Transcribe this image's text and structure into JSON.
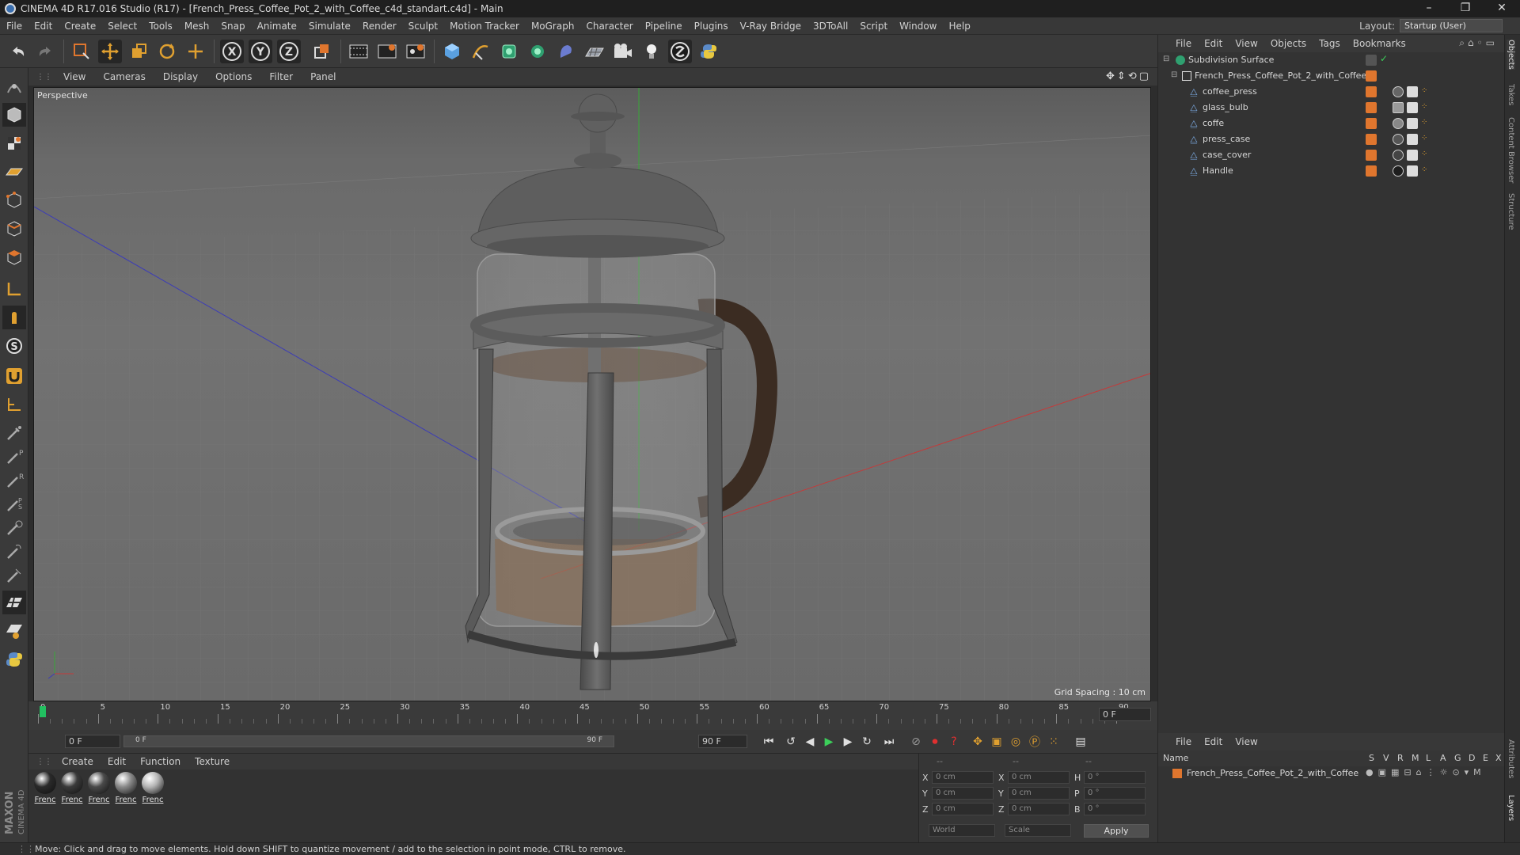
{
  "window": {
    "title": "CINEMA 4D R17.016 Studio (R17) - [French_Press_Coffee_Pot_2_with_Coffee_c4d_standart.c4d] - Main",
    "minimize": "–",
    "restore": "❐",
    "close": "✕"
  },
  "menu": [
    "File",
    "Edit",
    "Create",
    "Select",
    "Tools",
    "Mesh",
    "Snap",
    "Animate",
    "Simulate",
    "Render",
    "Sculpt",
    "Motion Tracker",
    "MoGraph",
    "Character",
    "Pipeline",
    "Plugins",
    "V-Ray Bridge",
    "3DToAll",
    "Script",
    "Window",
    "Help"
  ],
  "layout": {
    "label": "Layout:",
    "value": "Startup (User)"
  },
  "viewport": {
    "menu": [
      "View",
      "Cameras",
      "Display",
      "Options",
      "Filter",
      "Panel"
    ],
    "label": "Perspective",
    "grid_spacing": "Grid Spacing : 10 cm"
  },
  "timeline": {
    "ticks": [
      "0",
      "5",
      "10",
      "15",
      "20",
      "25",
      "30",
      "35",
      "40",
      "45",
      "50",
      "55",
      "60",
      "65",
      "70",
      "75",
      "80",
      "85",
      "90"
    ],
    "current_frame": "0 F",
    "start_field": "0 F",
    "range_start": "0 F",
    "range_end": "90 F",
    "end_field": "90 F"
  },
  "materials": {
    "menu": [
      "Create",
      "Edit",
      "Function",
      "Texture"
    ],
    "items": [
      {
        "name": "Frenc",
        "color": "#2a2a2a"
      },
      {
        "name": "Frenc",
        "color": "#3a3a3a"
      },
      {
        "name": "Frenc",
        "color": "#4a4a4a"
      },
      {
        "name": "Frenc",
        "color": "#8a8a8a"
      },
      {
        "name": "Frenc",
        "color": "#b5b5b5"
      }
    ]
  },
  "coords": {
    "headers": [
      "--",
      "--",
      "--"
    ],
    "rows": [
      {
        "l1": "X",
        "v1": "0 cm",
        "l2": "X",
        "v2": "0 cm",
        "l3": "H",
        "v3": "0 °"
      },
      {
        "l1": "Y",
        "v1": "0 cm",
        "l2": "Y",
        "v2": "0 cm",
        "l3": "P",
        "v3": "0 °"
      },
      {
        "l1": "Z",
        "v1": "0 cm",
        "l2": "Z",
        "v2": "0 cm",
        "l3": "B",
        "v3": "0 °"
      }
    ],
    "world": "World",
    "scale": "Scale",
    "apply": "Apply"
  },
  "objects": {
    "menu": [
      "File",
      "Edit",
      "View",
      "Objects",
      "Tags",
      "Bookmarks"
    ],
    "items": [
      {
        "name": "Subdivision Surface"
      },
      {
        "name": "French_Press_Coffee_Pot_2_with_Coffee"
      },
      {
        "name": "coffee_press"
      },
      {
        "name": "glass_bulb"
      },
      {
        "name": "coffe"
      },
      {
        "name": "press_case"
      },
      {
        "name": "case_cover"
      },
      {
        "name": "Handle"
      }
    ]
  },
  "right_tabs": [
    "Objects",
    "Takes",
    "Content Browser",
    "Structure",
    "Attributes",
    "Layers"
  ],
  "layers": {
    "menu": [
      "File",
      "Edit",
      "View"
    ],
    "columns": [
      "Name",
      "S",
      "V",
      "R",
      "M",
      "L",
      "A",
      "G",
      "D",
      "E",
      "X"
    ],
    "row": "French_Press_Coffee_Pot_2_with_Coffee"
  },
  "status": "Move: Click and drag to move elements. Hold down SHIFT to quantize movement / add to the selection in point mode, CTRL to remove.",
  "brand": {
    "line1": "MAXON",
    "line2": "CINEMA 4D"
  },
  "colors": {
    "accent_orange": "#e0762e",
    "selection_blue": "#3a6fb0",
    "viewport_bg": "#6e6e6e"
  }
}
